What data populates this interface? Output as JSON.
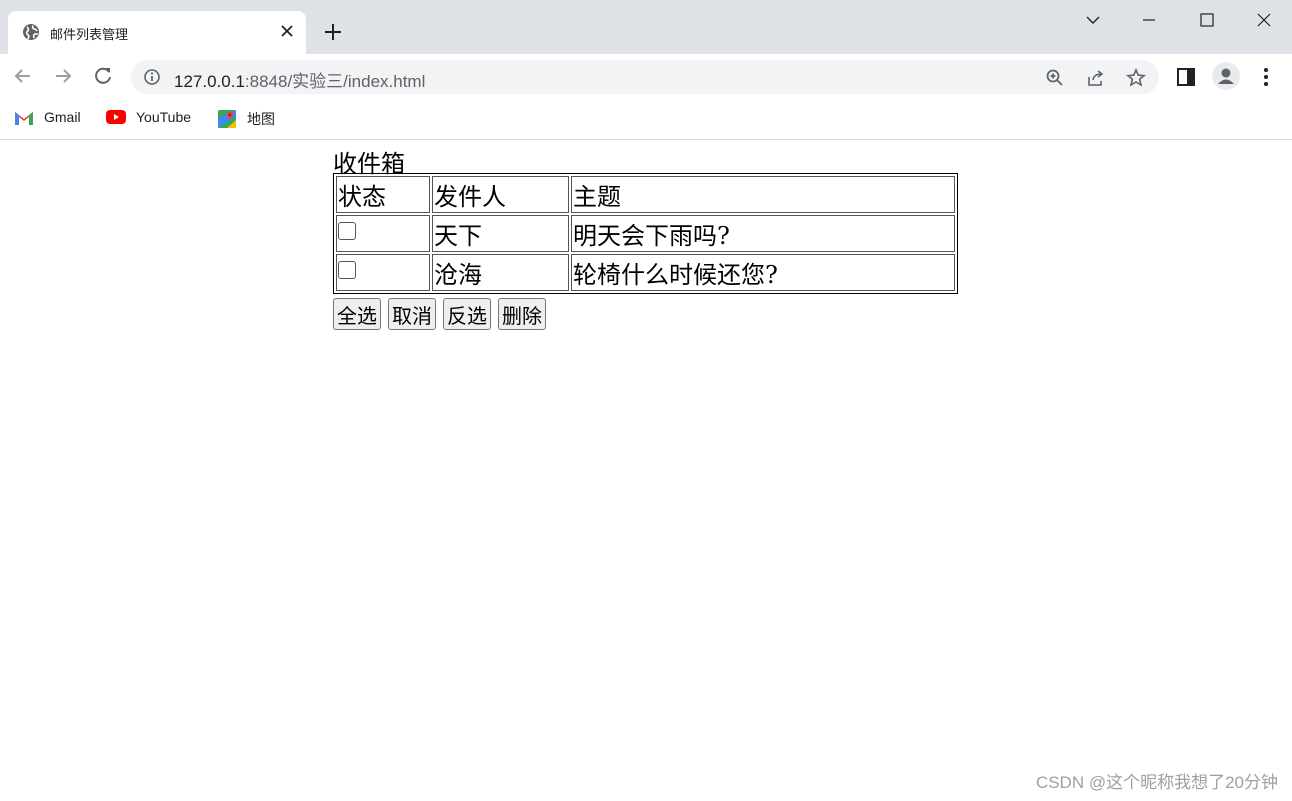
{
  "browser": {
    "tab": {
      "title": "邮件列表管理",
      "favicon": "globe-icon"
    },
    "address": {
      "host": "127.0.0.1",
      "path": ":8848/实验三/index.html"
    },
    "bookmarks": [
      {
        "label": "Gmail",
        "icon": "gmail-icon"
      },
      {
        "label": "YouTube",
        "icon": "youtube-icon"
      },
      {
        "label": "地图",
        "icon": "maps-icon"
      }
    ]
  },
  "page": {
    "heading": "收件箱",
    "table": {
      "headers": [
        "状态",
        "发件人",
        "主题"
      ],
      "rows": [
        {
          "checked": false,
          "sender": "天下",
          "subject": "明天会下雨吗?"
        },
        {
          "checked": false,
          "sender": "沧海",
          "subject": "轮椅什么时候还您?"
        }
      ]
    },
    "buttons": {
      "select_all": "全选",
      "cancel": "取消",
      "invert": "反选",
      "delete": "删除"
    }
  },
  "watermark": "CSDN @这个昵称我想了20分钟",
  "colors": {
    "tabstrip": "#dee1e6",
    "omnibox": "#f1f3f4",
    "text": "#202124"
  }
}
